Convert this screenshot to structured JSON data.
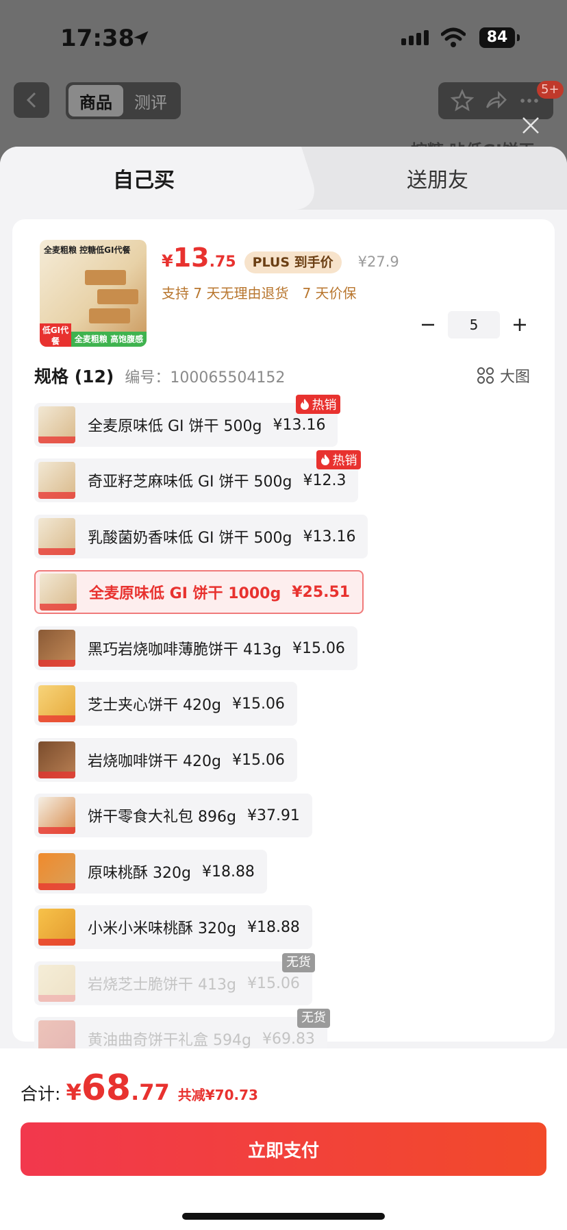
{
  "status_bar": {
    "time": "17:38",
    "battery": "84"
  },
  "nav": {
    "tabs": [
      "商品",
      "测评"
    ],
    "badge": "5+",
    "peek_text": "控糖 咔低GI饼干"
  },
  "sheet": {
    "tabs": {
      "self": "自己买",
      "friend": "送朋友"
    },
    "product": {
      "thumb_title": "全麦粗粮 控糖低GI代餐",
      "thumb_tag_left": "低GI代餐",
      "thumb_tag_right": "全麦粗粮 高饱腹感",
      "price_yen": "¥",
      "price_int": "13",
      "price_dec": ".75",
      "plus_label": "PLUS 到手价",
      "original_price": "¥27.9",
      "guarantee": [
        "支持 7 天无理由退货",
        "7 天价保"
      ],
      "quantity": "5"
    },
    "spec": {
      "title": "规格 (12)",
      "code": "编号：100065504152",
      "bigpic_label": "大图",
      "items": [
        {
          "name": "全麦原味低 GI 饼干 500g",
          "price": "¥13.16",
          "badge": "热销"
        },
        {
          "name": "奇亚籽芝麻味低 GI 饼干 500g",
          "price": "¥12.3",
          "badge": "热销"
        },
        {
          "name": "乳酸菌奶香味低 GI 饼干 500g",
          "price": "¥13.16"
        },
        {
          "name": "全麦原味低 GI 饼干 1000g",
          "price": "¥25.51",
          "selected": true
        },
        {
          "name": "黑巧岩烧咖啡薄脆饼干 413g",
          "price": "¥15.06"
        },
        {
          "name": "芝士夹心饼干 420g",
          "price": "¥15.06"
        },
        {
          "name": "岩烧咖啡饼干 420g",
          "price": "¥15.06"
        },
        {
          "name": "饼干零食大礼包 896g",
          "price": "¥37.91"
        },
        {
          "name": "原味桃酥 320g",
          "price": "¥18.88"
        },
        {
          "name": "小米小米味桃酥 320g",
          "price": "¥18.88"
        },
        {
          "name": "岩烧芝士脆饼干 413g",
          "price": "¥15.06",
          "badge": "无货",
          "disabled": true
        },
        {
          "name": "黄油曲奇饼干礼盒 594g",
          "price": "¥69.83",
          "badge": "无货",
          "disabled": true
        }
      ]
    }
  },
  "footer": {
    "total_label": "合计:",
    "total_yen": "¥",
    "total_int": "68",
    "total_dec": ".77",
    "saved": "共减¥70.73",
    "pay_label": "立即支付"
  },
  "colors": {
    "accent": "#e8322f",
    "plus_bg": "#f7e3cb",
    "guarantee": "#b8762e"
  }
}
